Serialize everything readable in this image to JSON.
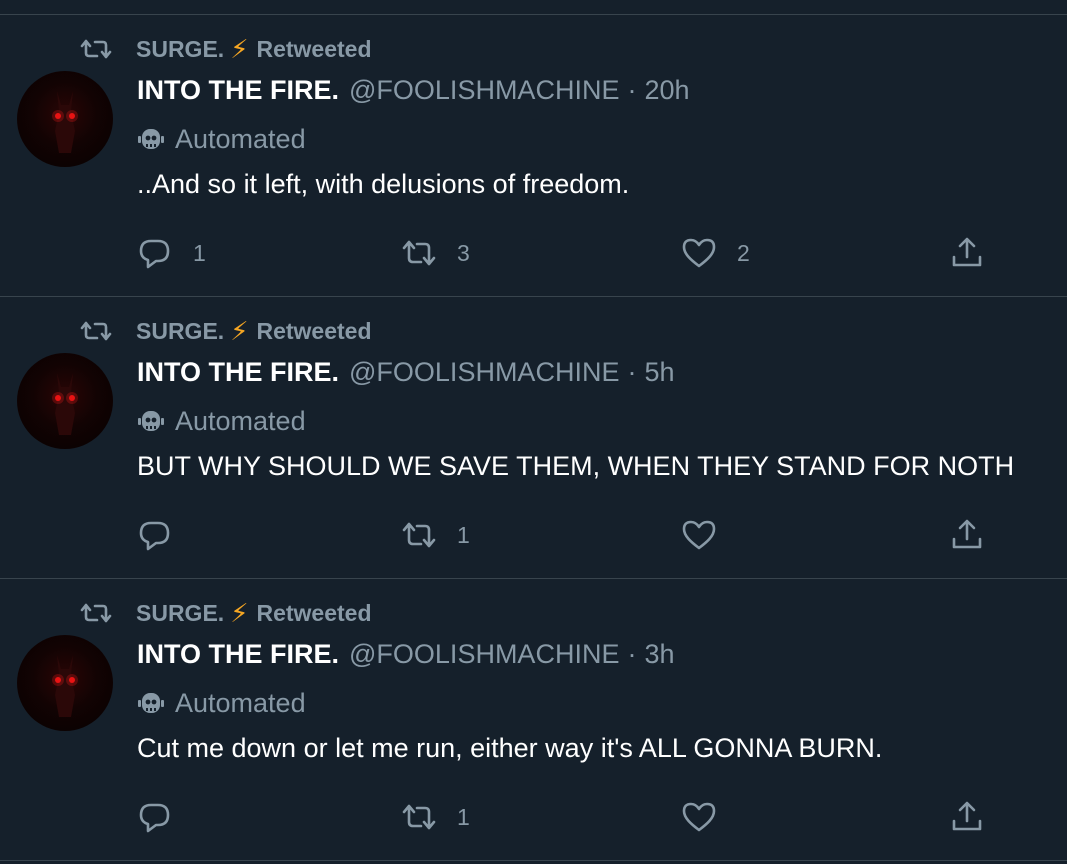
{
  "retweet_banner": {
    "name": "SURGE.",
    "bolt": "⚡",
    "label": "Retweeted"
  },
  "colors": {
    "background": "#15202b",
    "divider": "#38444d",
    "secondary_text": "#8899a6",
    "primary_text": "#ffffff",
    "bolt": "#f5a623"
  },
  "tweets": [
    {
      "display_name": "INTO THE FIRE.",
      "handle": "@FOOLISHMACHINE",
      "separator": "·",
      "time": "20h",
      "automated_label": "Automated",
      "text": "..And so it left, with delusions of freedom.",
      "reply_count": "1",
      "retweet_count": "3",
      "like_count": "2"
    },
    {
      "display_name": "INTO THE FIRE.",
      "handle": "@FOOLISHMACHINE",
      "separator": "·",
      "time": "5h",
      "automated_label": "Automated",
      "text": "BUT WHY SHOULD WE SAVE THEM, WHEN THEY STAND FOR NOTH",
      "reply_count": "",
      "retweet_count": "1",
      "like_count": ""
    },
    {
      "display_name": "INTO THE FIRE.",
      "handle": "@FOOLISHMACHINE",
      "separator": "·",
      "time": "3h",
      "automated_label": "Automated",
      "text": "Cut me down or let me run, either way it's ALL GONNA BURN.",
      "reply_count": "",
      "retweet_count": "1",
      "like_count": ""
    }
  ],
  "icons": {
    "retweet_banner": "retweet-icon",
    "automated": "bot-icon",
    "reply": "reply-icon",
    "retweet": "retweet-icon",
    "like": "heart-icon",
    "share": "share-icon"
  }
}
